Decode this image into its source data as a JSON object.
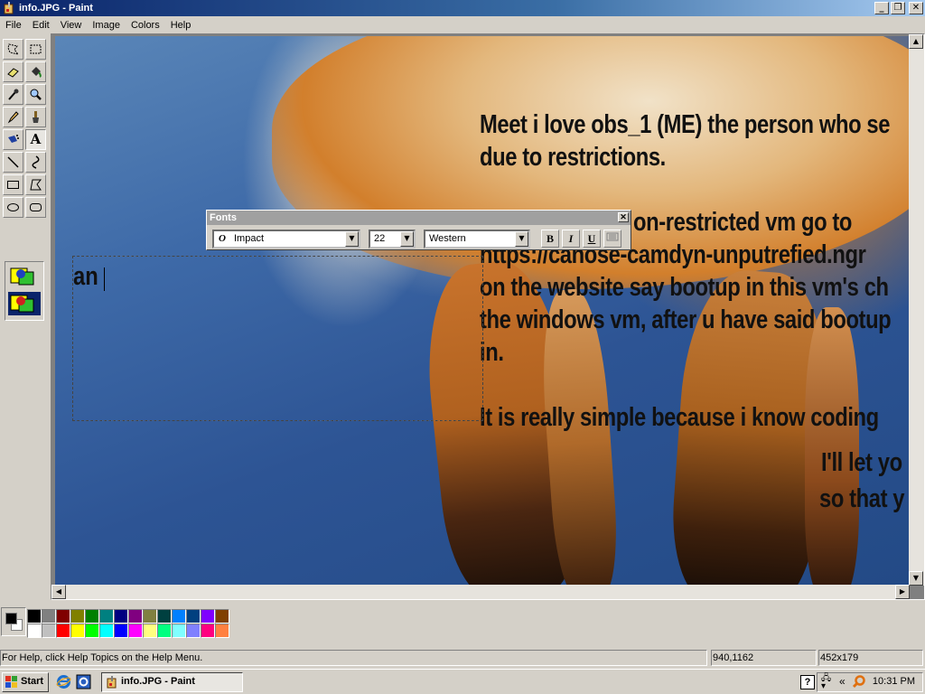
{
  "window": {
    "title": "info.JPG - Paint"
  },
  "menu": [
    "File",
    "Edit",
    "View",
    "Image",
    "Colors",
    "Help"
  ],
  "tools": [
    {
      "name": "free-form-select-icon"
    },
    {
      "name": "select-icon"
    },
    {
      "name": "eraser-icon"
    },
    {
      "name": "fill-with-color-icon"
    },
    {
      "name": "pick-color-icon"
    },
    {
      "name": "magnifier-icon"
    },
    {
      "name": "pencil-icon"
    },
    {
      "name": "brush-icon"
    },
    {
      "name": "airbrush-icon"
    },
    {
      "name": "text-icon",
      "glyph": "A",
      "active": true
    },
    {
      "name": "line-icon"
    },
    {
      "name": "curve-icon"
    },
    {
      "name": "rectangle-icon"
    },
    {
      "name": "polygon-icon"
    },
    {
      "name": "ellipse-icon"
    },
    {
      "name": "rounded-rectangle-icon"
    }
  ],
  "canvas": {
    "image_text_lines": [
      "Meet i love obs_1 (ME) the person who se",
      "due to restrictions.",
      "on-restricted vm go to",
      "https://canose-camdyn-unputrefied.ngr",
      "on the website say bootup in this vm's ch",
      "the windows vm, after u have said bootup",
      "in.",
      "It is really simple because i know coding",
      "I'll let yo",
      "so that y"
    ],
    "typed_text": "an"
  },
  "fonts_toolbar": {
    "title": "Fonts",
    "font_name": "Impact",
    "font_size": "22",
    "script": "Western",
    "bold_label": "B",
    "italic_label": "I",
    "underline_label": "U"
  },
  "palette": {
    "foreground": "#000000",
    "background": "#ffffff",
    "colors_top": [
      "#000000",
      "#808080",
      "#800000",
      "#808000",
      "#008000",
      "#008080",
      "#000080",
      "#800080",
      "#808040",
      "#004040",
      "#0080ff",
      "#004080",
      "#8000ff",
      "#804000"
    ],
    "colors_bottom": [
      "#ffffff",
      "#c0c0c0",
      "#ff0000",
      "#ffff00",
      "#00ff00",
      "#00ffff",
      "#0000ff",
      "#ff00ff",
      "#ffff80",
      "#00ff80",
      "#80ffff",
      "#8080ff",
      "#ff0080",
      "#ff8040"
    ]
  },
  "statusbar": {
    "help_text": "For Help, click Help Topics on the Help Menu.",
    "cursor_position": "940,1162",
    "selection_size": "452x179"
  },
  "taskbar": {
    "start_label": "Start",
    "task_label": "info.JPG - Paint",
    "help_icon_label": "?",
    "clock": "10:31 PM"
  }
}
